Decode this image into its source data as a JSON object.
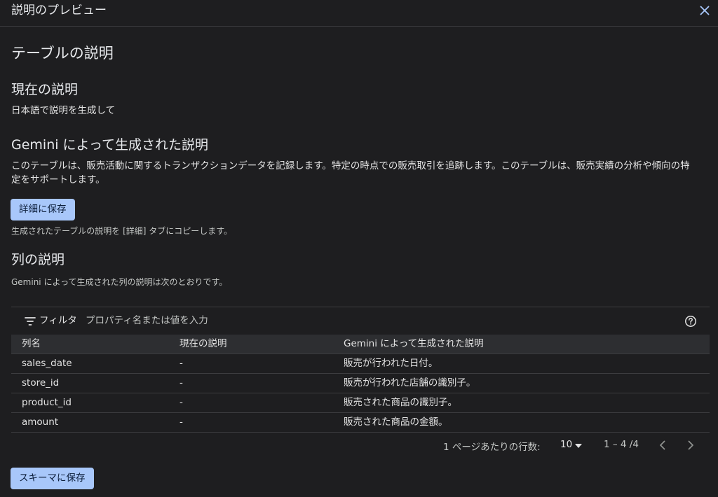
{
  "dialog": {
    "title": "説明のプレビュー"
  },
  "main": {
    "heading": "テーブルの説明",
    "current": {
      "heading": "現在の説明",
      "text": "日本語で説明を生成して"
    },
    "gemini": {
      "heading": "Gemini によって生成された説明",
      "text_line1": "このテーブルは、販売活動に関するトランザクションデータを記録します。特定の時点での販売取引を追跡します。このテーブルは、販売実績の分析や傾向の特",
      "text_line2": "定をサポートします。",
      "save_button": "詳細に保存",
      "hint": "生成されたテーブルの説明を [詳細] タブにコピーします。"
    },
    "columns": {
      "heading": "列の説明",
      "subtext": "Gemini によって生成された列の説明は次のとおりです。"
    }
  },
  "table": {
    "filter_label": "フィルタ",
    "filter_placeholder": "プロパティ名または値を入力",
    "headers": [
      "列名",
      "現在の説明",
      "Gemini によって生成された説明"
    ],
    "rows": [
      [
        "sales_date",
        "-",
        "販売が行われた日付。"
      ],
      [
        "store_id",
        "-",
        "販売が行われた店舗の識別子。"
      ],
      [
        "product_id",
        "-",
        "販売された商品の識別子。"
      ],
      [
        "amount",
        "-",
        "販売された商品の金額。"
      ]
    ]
  },
  "pagination": {
    "rows_per_page_label": "1 ページあたりの行数:",
    "rows_per_page": "10",
    "range": "1 – 4 /4"
  },
  "footer": {
    "save_schema_button": "スキーマに保存"
  },
  "colors": {
    "background": "#1e1e20",
    "primary_button": "#a8c7fa",
    "close_icon": "#a8c7fa"
  },
  "icons": [
    "close-icon",
    "filter-icon",
    "help-icon",
    "dropdown-caret-icon",
    "chevron-left-icon",
    "chevron-right-icon"
  ]
}
